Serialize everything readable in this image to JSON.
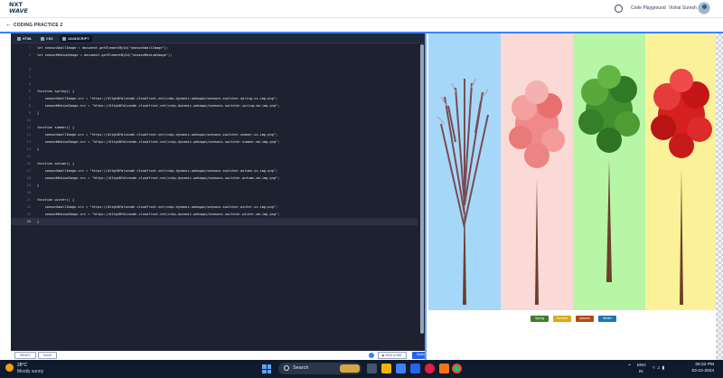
{
  "topnav": {
    "logo_line1": "NXT",
    "logo_line2": "WAVE",
    "link": "Code Playground",
    "user": "Vishal Suresh"
  },
  "breadcrumb": {
    "title": "CODING PRACTICE 2"
  },
  "editor": {
    "tabs": [
      {
        "label": "HTML"
      },
      {
        "label": "CSS"
      },
      {
        "label": "JAVASCRIPT"
      }
    ],
    "lines": [
      {
        "n": "1",
        "code": "let seasonSmallImage = document.getElementById(\"seasonSmallImage\");"
      },
      {
        "n": "2",
        "code": "let seasonMediumImage = document.getElementById(\"seasonMediumImage\");"
      },
      {
        "n": "3",
        "code": ""
      },
      {
        "n": "4",
        "code": ""
      },
      {
        "n": "5",
        "code": ""
      },
      {
        "n": "6",
        "code": "function spring() {"
      },
      {
        "n": "7",
        "code": "    seasonSmallImage.src = \"https://d1tgh8fmlzexmh.cloudfront.net/ccbp-dynamic-webapps/seasons-switcher-spring-xs-img.png\";"
      },
      {
        "n": "8",
        "code": "    seasonMediumImage.src = \"https://d1tgh8fmlzexmh.cloudfront.net/ccbp-dynamic-webapps/seasons-switcher-spring-md-img.png\";"
      },
      {
        "n": "9",
        "code": "}"
      },
      {
        "n": "10",
        "code": ""
      },
      {
        "n": "11",
        "code": "function summer() {"
      },
      {
        "n": "12",
        "code": "    seasonSmallImage.src = \"https://d1tgh8fmlzexmh.cloudfront.net/ccbp-dynamic-webapps/seasons-switcher-summer-xs-img.png\";"
      },
      {
        "n": "13",
        "code": "    seasonMediumImage.src = \"https://d1tgh8fmlzexmh.cloudfront.net/ccbp-dynamic-webapps/seasons-switcher-summer-md-img.png\";"
      },
      {
        "n": "14",
        "code": "}"
      },
      {
        "n": "15",
        "code": ""
      },
      {
        "n": "16",
        "code": "function autumn() {"
      },
      {
        "n": "17",
        "code": "    seasonSmallImage.src = \"https://d1tgh8fmlzexmh.cloudfront.net/ccbp-dynamic-webapps/seasons-switcher-autumn-xs-img.png\";"
      },
      {
        "n": "18",
        "code": "    seasonMediumImage.src = \"https://d1tgh8fmlzexmh.cloudfront.net/ccbp-dynamic-webapps/seasons-switcher-autumn-md-img.png\";"
      },
      {
        "n": "19",
        "code": "}"
      },
      {
        "n": "20",
        "code": ""
      },
      {
        "n": "21",
        "code": "function winter() {"
      },
      {
        "n": "22",
        "code": "    seasonSmallImage.src = \"https://d1tgh8fmlzexmh.cloudfront.net/ccbp-dynamic-webapps/seasons-switcher-winter-xs-img.png\";"
      },
      {
        "n": "23",
        "code": "    seasonMediumImage.src = \"https://d1tgh8fmlzexmh.cloudfront.net/ccbp-dynamic-webapps/seasons-switcher-winter-md-img.png\";"
      },
      {
        "n": "24",
        "code": "}"
      }
    ],
    "footer": {
      "reset": "RESET",
      "save": "SAVE",
      "run": "RUN CODE",
      "submit": "Submit"
    }
  },
  "preview": {
    "panels": [
      {
        "name": "winter-panel",
        "bg": "#a5d8f8"
      },
      {
        "name": "spring-panel",
        "bg": "#fbd9d6"
      },
      {
        "name": "summer-panel",
        "bg": "#b7f5a7"
      },
      {
        "name": "autumn-panel",
        "bg": "#fbf199"
      }
    ],
    "buttons": [
      {
        "label": "Spring",
        "color": "#3f7d2f"
      },
      {
        "label": "Summer",
        "color": "#d9a91b"
      },
      {
        "label": "Autumn",
        "color": "#b34a12"
      },
      {
        "label": "Winter",
        "color": "#1d75b5"
      }
    ]
  },
  "taskbar": {
    "temp": "28°C",
    "condition": "Mostly sunny",
    "search": "Search",
    "lang1": "ENG",
    "lang2": "IN",
    "time": "06:22 PM",
    "date": "03-10-2023"
  }
}
